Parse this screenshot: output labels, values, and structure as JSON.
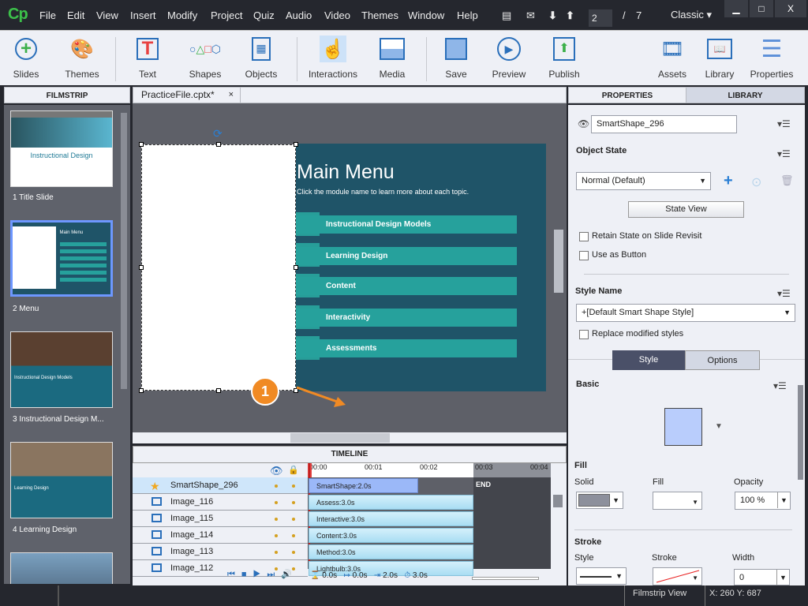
{
  "app": {
    "logo": "Cp"
  },
  "menu": [
    "File",
    "Edit",
    "View",
    "Insert",
    "Modify",
    "Project",
    "Quiz",
    "Audio",
    "Video",
    "Themes",
    "Window",
    "Help"
  ],
  "slide_nav": {
    "current": "2",
    "separator": "/",
    "total": "7"
  },
  "workspace": "Classic",
  "window_buttons": {
    "minimize": "▁",
    "maximize": "□",
    "close": "X"
  },
  "toolbar": {
    "slides": "Slides",
    "themes": "Themes",
    "text": "Text",
    "shapes": "Shapes",
    "objects": "Objects",
    "interactions": "Interactions",
    "media": "Media",
    "save": "Save",
    "preview": "Preview",
    "publish": "Publish",
    "assets": "Assets",
    "library": "Library",
    "properties": "Properties"
  },
  "panels": {
    "filmstrip": "FILMSTRIP",
    "doc_tab": "PracticeFile.cptx*",
    "doc_close": "×",
    "properties": "PROPERTIES",
    "library": "LIBRARY",
    "timeline": "TIMELINE"
  },
  "filmstrip": [
    {
      "label": "1 Title Slide",
      "title": "Instructional Design"
    },
    {
      "label": "2 Menu",
      "title": "Main Menu"
    },
    {
      "label": "3 Instructional Design M...",
      "title": "Instructional Design Models"
    },
    {
      "label": "4 Learning Design",
      "title": "Learning Design"
    }
  ],
  "slide": {
    "title": "Main Menu",
    "subtitle": "Click the module name to learn more about each topic.",
    "buttons": [
      "Instructional Design Models",
      "Learning Design",
      "Content",
      "Interactivity",
      "Assessments"
    ],
    "callout": "1"
  },
  "timeline": {
    "ticks": [
      "00:00",
      "00:01",
      "00:02",
      "00:03",
      "00:04"
    ],
    "rows": [
      {
        "name": "SmartShape_296",
        "bar": "SmartShape:2.0s",
        "selected": true
      },
      {
        "name": "Image_116",
        "bar": "Assess:3.0s"
      },
      {
        "name": "Image_115",
        "bar": "Interactive:3.0s"
      },
      {
        "name": "Image_114",
        "bar": "Content:3.0s"
      },
      {
        "name": "Image_113",
        "bar": "Method:3.0s"
      },
      {
        "name": "Image_112",
        "bar": "Lightbulb:3.0s"
      }
    ],
    "end": "END",
    "footer": {
      "start": "0.0s",
      "appear": "0.0s",
      "duration": "2.0s",
      "slide": "3.0s"
    }
  },
  "properties": {
    "name": "SmartShape_296",
    "object_state": "Object State",
    "state_value": "Normal (Default)",
    "state_view": "State View",
    "retain_state": "Retain State on Slide Revisit",
    "use_as_button": "Use as Button",
    "style_name": "Style Name",
    "style_value": "+[Default Smart Shape Style]",
    "replace_styles": "Replace modified styles",
    "tab_style": "Style",
    "tab_options": "Options",
    "basic": "Basic",
    "fill": "Fill",
    "fill_type_label": "Solid",
    "fill_label": "Fill",
    "opacity_label": "Opacity",
    "opacity": "100 %",
    "stroke": "Stroke",
    "stroke_style_label": "Style",
    "stroke_label": "Stroke",
    "width_label": "Width",
    "width": "0",
    "swatch_color": "#b9cdfc"
  },
  "status": {
    "view": "Filmstrip View",
    "coords": "X: 260 Y: 687"
  },
  "colors": {
    "slide_bg": "#1f5468",
    "button": "#26a19c",
    "accent": "#f08a24",
    "selection": "#6d97ff"
  }
}
